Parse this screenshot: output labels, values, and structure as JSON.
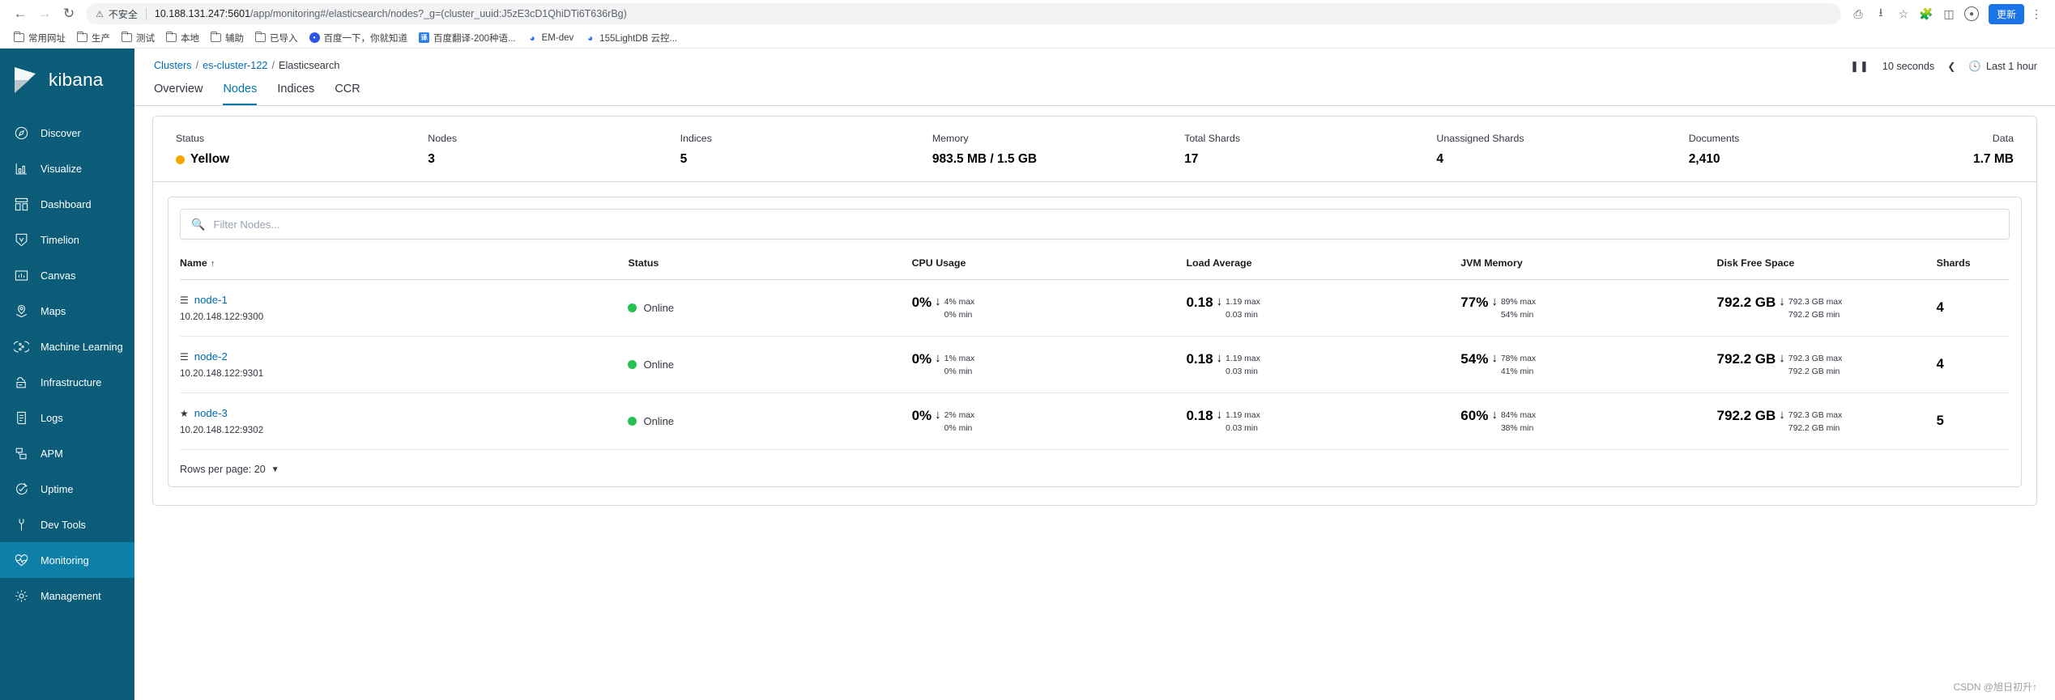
{
  "browser": {
    "back_icon": "back-arrow-icon",
    "forward_icon": "forward-arrow-icon",
    "reload_icon": "reload-icon",
    "security_label": "不安全",
    "url_host": "10.188.131.247:5601",
    "url_path": "/app/monitoring#/elasticsearch/nodes?_g=(cluster_uuid:J5zE3cD1QhiDTi6T636rBg)",
    "update_button": "更新",
    "bookmarks": [
      {
        "label": "常用网址",
        "icon": "folder-icon",
        "type": "folder"
      },
      {
        "label": "生产",
        "icon": "folder-icon",
        "type": "folder"
      },
      {
        "label": "测试",
        "icon": "folder-icon",
        "type": "folder"
      },
      {
        "label": "本地",
        "icon": "folder-icon",
        "type": "folder"
      },
      {
        "label": "辅助",
        "icon": "folder-icon",
        "type": "folder"
      },
      {
        "label": "已导入",
        "icon": "folder-icon",
        "type": "folder"
      },
      {
        "label": "百度一下，你就知道",
        "icon": "baidu-favicon",
        "type": "baidu"
      },
      {
        "label": "百度翻译-200种语...",
        "icon": "baidu-translate-favicon",
        "type": "trans"
      },
      {
        "label": "EM-dev",
        "icon": "em-favicon",
        "type": "em"
      },
      {
        "label": "155LightDB 云控...",
        "icon": "lightdb-favicon",
        "type": "em"
      }
    ]
  },
  "sidebar": {
    "brand": "kibana",
    "items": [
      {
        "label": "Discover",
        "icon": "compass-icon",
        "active": false
      },
      {
        "label": "Visualize",
        "icon": "bar-chart-icon",
        "active": false
      },
      {
        "label": "Dashboard",
        "icon": "dashboard-grid-icon",
        "active": false
      },
      {
        "label": "Timelion",
        "icon": "timelion-icon",
        "active": false
      },
      {
        "label": "Canvas",
        "icon": "canvas-icon",
        "active": false
      },
      {
        "label": "Maps",
        "icon": "map-pin-icon",
        "active": false
      },
      {
        "label": "Machine Learning",
        "icon": "machine-learning-icon",
        "active": false
      },
      {
        "label": "Infrastructure",
        "icon": "infrastructure-icon",
        "active": false
      },
      {
        "label": "Logs",
        "icon": "logs-icon",
        "active": false
      },
      {
        "label": "APM",
        "icon": "apm-icon",
        "active": false
      },
      {
        "label": "Uptime",
        "icon": "uptime-icon",
        "active": false
      },
      {
        "label": "Dev Tools",
        "icon": "wrench-icon",
        "active": false
      },
      {
        "label": "Monitoring",
        "icon": "heartbeat-icon",
        "active": true
      },
      {
        "label": "Management",
        "icon": "gear-icon",
        "active": false
      }
    ]
  },
  "breadcrumb": {
    "clusters": "Clusters",
    "cluster": "es-cluster-122",
    "current": "Elasticsearch"
  },
  "tabs": [
    {
      "label": "Overview",
      "active": false
    },
    {
      "label": "Nodes",
      "active": true
    },
    {
      "label": "Indices",
      "active": false
    },
    {
      "label": "CCR",
      "active": false
    }
  ],
  "time_controls": {
    "pause_icon": "pause-icon",
    "refresh_interval": "10 seconds",
    "prev_icon": "chevron-left-icon",
    "clock_icon": "clock-icon",
    "range": "Last 1 hour"
  },
  "summary": [
    {
      "label": "Status",
      "value": "Yellow",
      "dot_color": "#f5a700"
    },
    {
      "label": "Nodes",
      "value": "3"
    },
    {
      "label": "Indices",
      "value": "5"
    },
    {
      "label": "Memory",
      "value": "983.5 MB / 1.5 GB"
    },
    {
      "label": "Total Shards",
      "value": "17"
    },
    {
      "label": "Unassigned Shards",
      "value": "4"
    },
    {
      "label": "Documents",
      "value": "2,410"
    },
    {
      "label": "Data",
      "value": "1.7 MB"
    }
  ],
  "search": {
    "placeholder": "Filter Nodes...",
    "value": "",
    "icon": "search-icon"
  },
  "table": {
    "columns": [
      {
        "label": "Name",
        "sorted": true,
        "sort_icon": "↑"
      },
      {
        "label": "Status"
      },
      {
        "label": "CPU Usage"
      },
      {
        "label": "Load Average"
      },
      {
        "label": "JVM Memory"
      },
      {
        "label": "Disk Free Space"
      },
      {
        "label": "Shards"
      }
    ],
    "rows": [
      {
        "name": "node-1",
        "name_icon": "server-icon",
        "ip": "10.20.148.122:9300",
        "status": "Online",
        "status_color": "#25c151",
        "cpu": {
          "value": "0%",
          "trend": "↓",
          "max": "4% max",
          "min": "0% min"
        },
        "load": {
          "value": "0.18",
          "trend": "↓",
          "max": "1.19 max",
          "min": "0.03 min"
        },
        "jvm": {
          "value": "77%",
          "trend": "↓",
          "max": "89% max",
          "min": "54% min"
        },
        "disk": {
          "value": "792.2 GB",
          "trend": "↓",
          "max": "792.3 GB max",
          "min": "792.2 GB min"
        },
        "shards": "4"
      },
      {
        "name": "node-2",
        "name_icon": "server-icon",
        "ip": "10.20.148.122:9301",
        "status": "Online",
        "status_color": "#25c151",
        "cpu": {
          "value": "0%",
          "trend": "↓",
          "max": "1% max",
          "min": "0% min"
        },
        "load": {
          "value": "0.18",
          "trend": "↓",
          "max": "1.19 max",
          "min": "0.03 min"
        },
        "jvm": {
          "value": "54%",
          "trend": "↓",
          "max": "78% max",
          "min": "41% min"
        },
        "disk": {
          "value": "792.2 GB",
          "trend": "↓",
          "max": "792.3 GB max",
          "min": "792.2 GB min"
        },
        "shards": "4"
      },
      {
        "name": "node-3",
        "name_icon": "star-icon",
        "ip": "10.20.148.122:9302",
        "status": "Online",
        "status_color": "#25c151",
        "cpu": {
          "value": "0%",
          "trend": "↓",
          "max": "2% max",
          "min": "0% min"
        },
        "load": {
          "value": "0.18",
          "trend": "↓",
          "max": "1.19 max",
          "min": "0.03 min"
        },
        "jvm": {
          "value": "60%",
          "trend": "↓",
          "max": "84% max",
          "min": "38% min"
        },
        "disk": {
          "value": "792.2 GB",
          "trend": "↓",
          "max": "792.3 GB max",
          "min": "792.2 GB min"
        },
        "shards": "5"
      }
    ],
    "rows_per_page_label": "Rows per page: 20"
  },
  "watermark": "CSDN @旭日初升↑"
}
